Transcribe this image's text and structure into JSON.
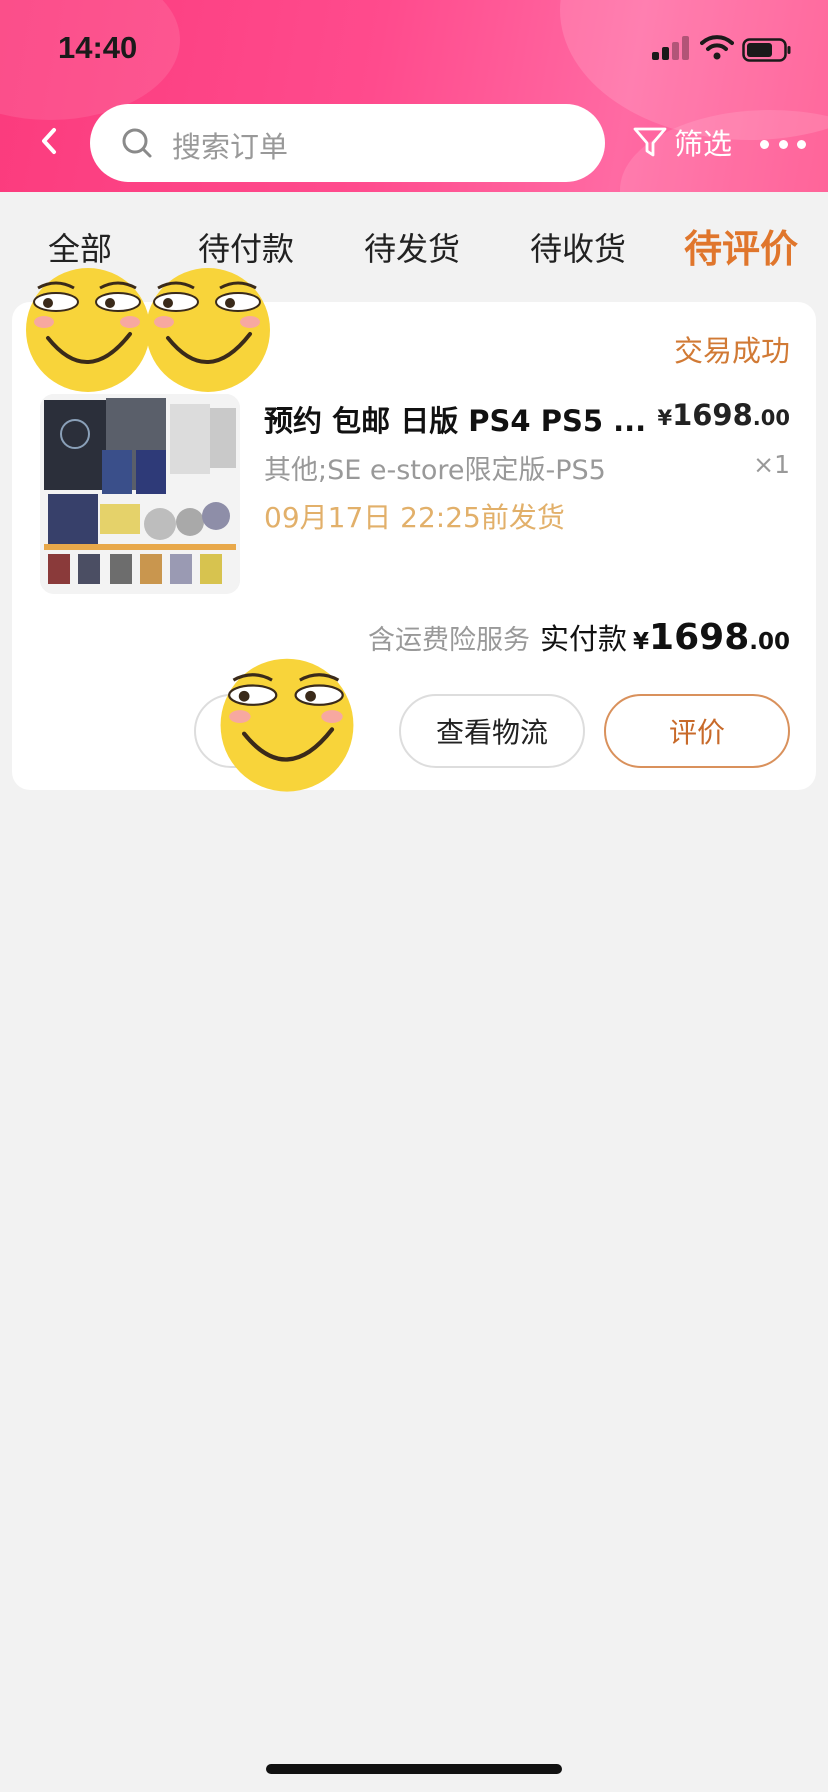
{
  "status_bar": {
    "time": "14:40"
  },
  "header": {
    "search_placeholder": "搜索订单",
    "filter_label": "筛选",
    "icons": {
      "back": "chevron-left-icon",
      "search": "search-icon",
      "filter": "funnel-icon",
      "more": "more-dots-icon"
    }
  },
  "tabs": [
    {
      "label": "全部"
    },
    {
      "label": "待付款"
    },
    {
      "label": "待发货"
    },
    {
      "label": "待收货"
    },
    {
      "label": "待评价",
      "active": true
    }
  ],
  "order": {
    "status": "交易成功",
    "title": "预约 包邮 日版 PS4 PS5 ...",
    "unit_price": {
      "currency": "¥",
      "integer": "1698",
      "decimal": ".00"
    },
    "spec": "其他;SE e-store限定版-PS5",
    "quantity": "×1",
    "ship_note": "09月17日 22:25前发货",
    "service_note": "含运费险服务",
    "paid_label": "实付款",
    "paid_total": {
      "currency": "¥",
      "integer": "1698",
      "decimal": ".00"
    },
    "buttons": {
      "logistics": "查看物流",
      "review": "评价"
    }
  },
  "colors": {
    "header": "#fb3b7d",
    "accent": "#e0762c",
    "ship_note": "#e2b06a"
  }
}
